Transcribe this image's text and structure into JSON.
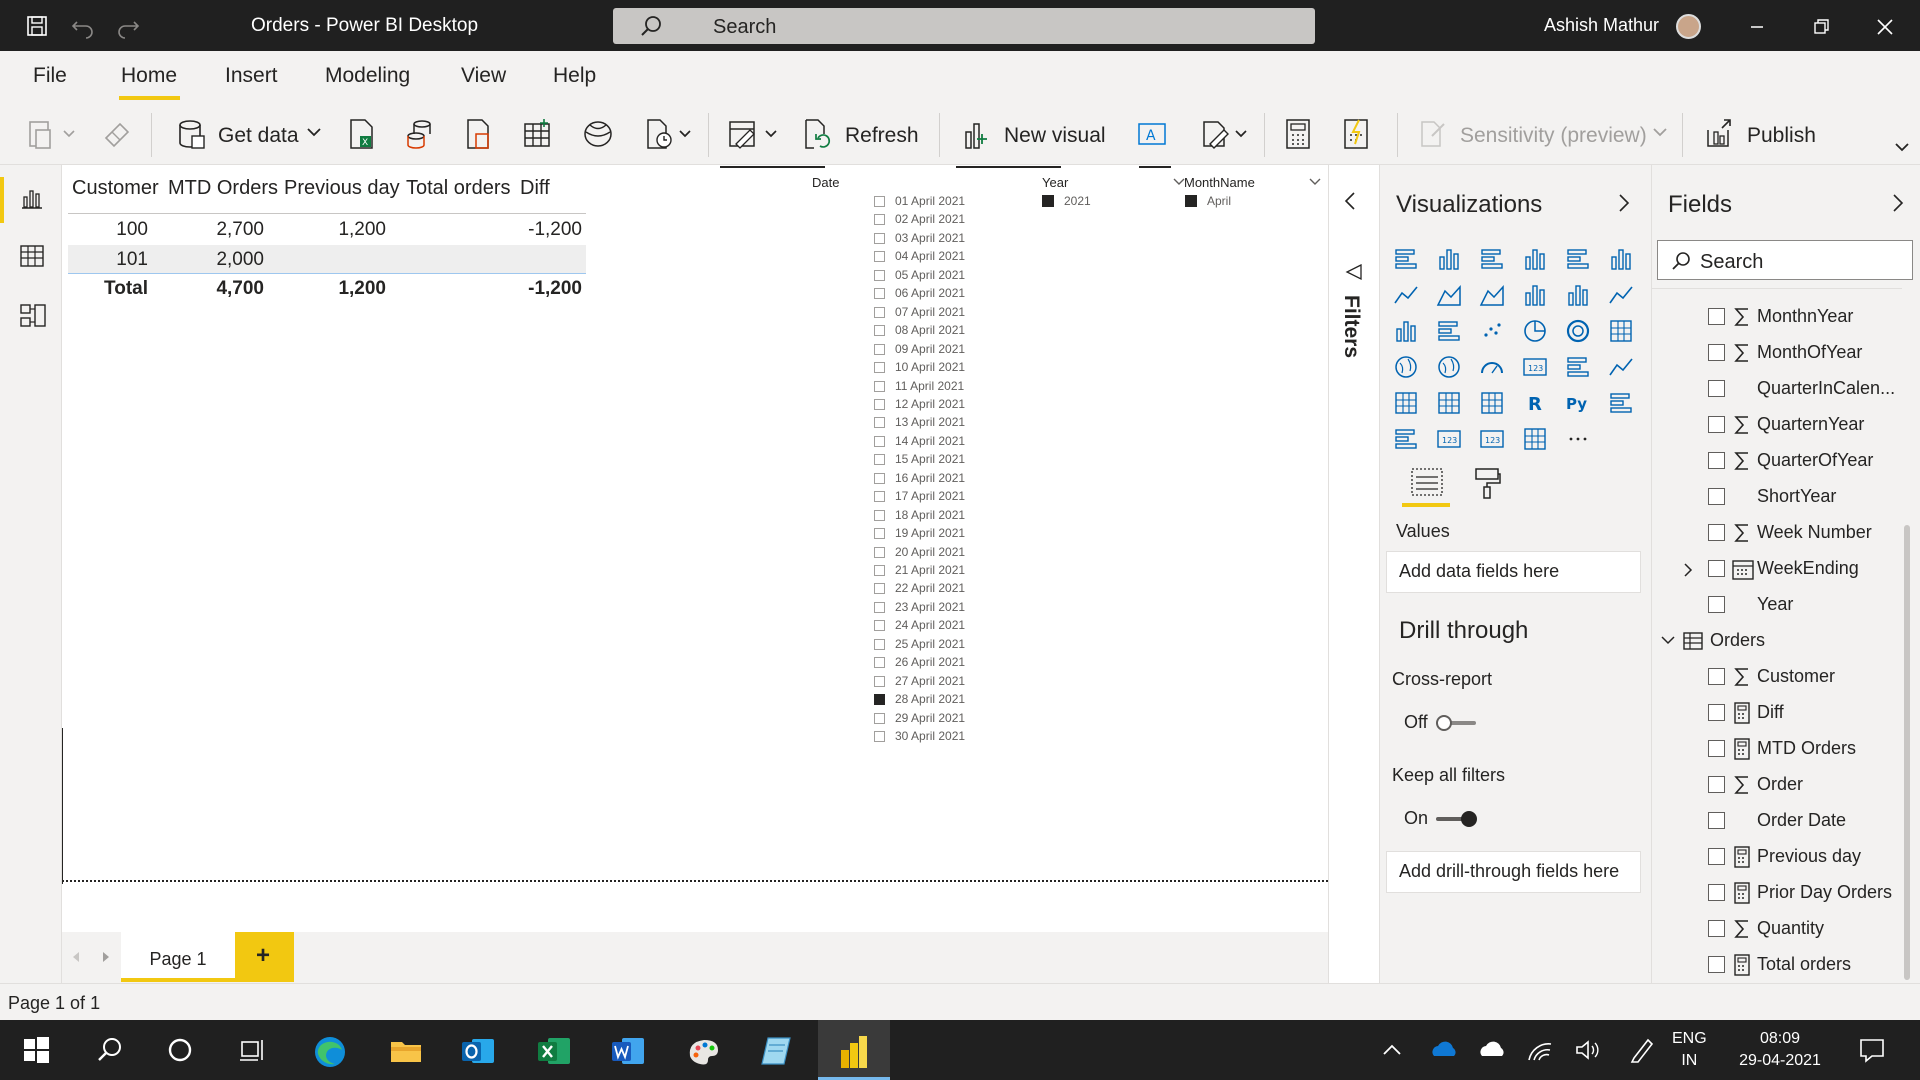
{
  "titlebar": {
    "title": "Orders - Power BI Desktop",
    "search_placeholder": "Search",
    "user_name": "Ashish Mathur"
  },
  "menu": {
    "items": [
      "File",
      "Home",
      "Insert",
      "Modeling",
      "View",
      "Help"
    ],
    "active": "Home"
  },
  "ribbon": {
    "get_data": "Get data",
    "refresh": "Refresh",
    "new_visual": "New visual",
    "sensitivity": "Sensitivity (preview)",
    "publish": "Publish"
  },
  "table_visual": {
    "headers": [
      "Customer",
      "MTD Orders",
      "Previous day",
      "Total orders",
      "Diff"
    ],
    "rows": [
      [
        "100",
        "2,700",
        "1,200",
        "",
        "-1,200"
      ],
      [
        "101",
        "2,000",
        "",
        "",
        ""
      ]
    ],
    "total": [
      "Total",
      "4,700",
      "1,200",
      "",
      "-1,200"
    ]
  },
  "date_slicer": {
    "header": "Date",
    "dates": [
      "01 April 2021",
      "02 April 2021",
      "03 April 2021",
      "04 April 2021",
      "05 April 2021",
      "06 April 2021",
      "07 April 2021",
      "08 April 2021",
      "09 April 2021",
      "10 April 2021",
      "11 April 2021",
      "12 April 2021",
      "13 April 2021",
      "14 April 2021",
      "15 April 2021",
      "16 April 2021",
      "17 April 2021",
      "18 April 2021",
      "19 April 2021",
      "20 April 2021",
      "21 April 2021",
      "22 April 2021",
      "23 April 2021",
      "24 April 2021",
      "25 April 2021",
      "26 April 2021",
      "27 April 2021",
      "28 April 2021",
      "29 April 2021",
      "30 April 2021"
    ],
    "selected": "28 April 2021"
  },
  "year_slicer": {
    "header": "Year",
    "value": "2021"
  },
  "month_slicer": {
    "header": "MonthName",
    "value": "April"
  },
  "filters_pane": {
    "label": "Filters"
  },
  "viz_pane": {
    "title": "Visualizations",
    "values_label": "Values",
    "values_dropzone": "Add data fields here",
    "drill_through_title": "Drill through",
    "cross_report_label": "Cross-report",
    "cross_report_state": "Off",
    "keep_filters_label": "Keep all filters",
    "keep_filters_state": "On",
    "drill_dropzone": "Add drill-through fields here"
  },
  "fields_pane": {
    "title": "Fields",
    "search_placeholder": "Search",
    "items": [
      {
        "name": "MonthnYear",
        "icon": "sigma-icon"
      },
      {
        "name": "MonthOfYear",
        "icon": "sigma-icon"
      },
      {
        "name": "QuarterInCalen...",
        "icon": "none"
      },
      {
        "name": "QuarternYear",
        "icon": "sigma-icon"
      },
      {
        "name": "QuarterOfYear",
        "icon": "sigma-icon"
      },
      {
        "name": "ShortYear",
        "icon": "none"
      },
      {
        "name": "Week Number",
        "icon": "sigma-icon"
      },
      {
        "name": "WeekEnding",
        "icon": "calendar-icon"
      },
      {
        "name": "Year",
        "icon": "none"
      },
      {
        "name": "Orders",
        "icon": "table-icon"
      },
      {
        "name": "Customer",
        "icon": "sigma-icon"
      },
      {
        "name": "Diff",
        "icon": "calculator-icon"
      },
      {
        "name": "MTD Orders",
        "icon": "calculator-icon"
      },
      {
        "name": "Order",
        "icon": "sigma-icon"
      },
      {
        "name": "Order Date",
        "icon": "none"
      },
      {
        "name": "Previous day",
        "icon": "calculator-icon"
      },
      {
        "name": "Prior Day Orders",
        "icon": "calculator-icon"
      },
      {
        "name": "Quantity",
        "icon": "sigma-icon"
      },
      {
        "name": "Total orders",
        "icon": "calculator-icon"
      }
    ]
  },
  "page_tabs": {
    "tabs": [
      "Page 1"
    ],
    "add_symbol": "+"
  },
  "status": {
    "text": "Page 1 of 1"
  },
  "taskbar": {
    "lang_top": "ENG",
    "lang_bottom": "IN",
    "time": "08:09",
    "date": "29-04-2021"
  },
  "colors": {
    "accent": "#f2c811",
    "titlebar": "#202020",
    "pane": "#f3f2f1"
  }
}
